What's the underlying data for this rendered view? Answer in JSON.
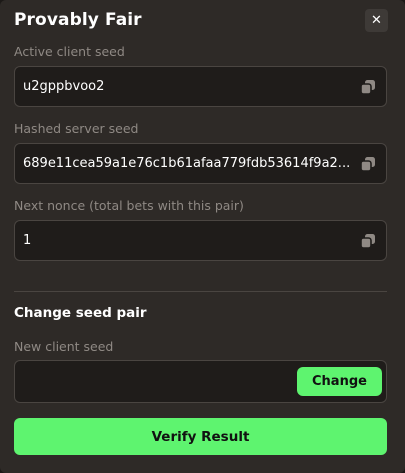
{
  "modal": {
    "title": "Provably Fair",
    "close_label": "✕"
  },
  "fields": {
    "client_seed": {
      "label": "Active client seed",
      "value": "u2gppbvoo2"
    },
    "server_seed": {
      "label": "Hashed server seed",
      "value": "689e11cea59a1e76c1b61afaa779fdb53614f9a2..."
    },
    "nonce": {
      "label": "Next nonce (total bets with this pair)",
      "value": "1"
    }
  },
  "change_section": {
    "title": "Change seed pair",
    "new_seed_label": "New client seed",
    "new_seed_value": "",
    "change_button": "Change"
  },
  "verify_button": "Verify Result",
  "colors": {
    "accent": "#5ef46f",
    "background": "#2e2a27",
    "field_bg": "#1f1c1a",
    "border": "#4a4541",
    "muted_text": "#8f8984"
  },
  "icons": {
    "copy": "copy-icon",
    "close": "close-icon"
  }
}
